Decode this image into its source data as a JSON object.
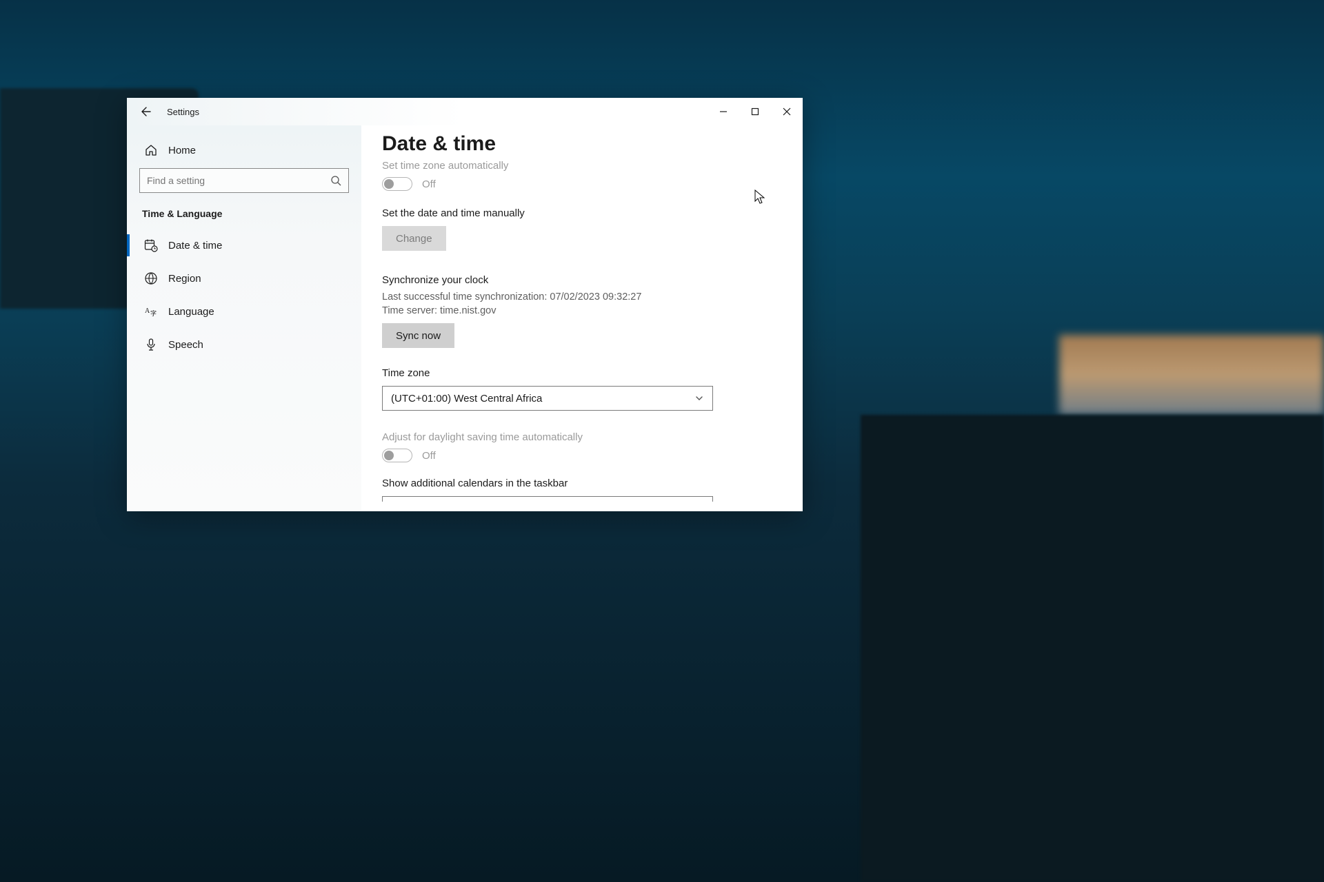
{
  "window": {
    "title": "Settings"
  },
  "sidebar": {
    "home_label": "Home",
    "search_placeholder": "Find a setting",
    "section_title": "Time & Language",
    "items": [
      {
        "label": "Date & time"
      },
      {
        "label": "Region"
      },
      {
        "label": "Language"
      },
      {
        "label": "Speech"
      }
    ]
  },
  "page": {
    "title": "Date & time",
    "auto_tz": {
      "label": "Set time zone automatically",
      "state": "Off"
    },
    "manual": {
      "label": "Set the date and time manually",
      "button": "Change"
    },
    "sync": {
      "heading": "Synchronize your clock",
      "last_sync": "Last successful time synchronization: 07/02/2023 09:32:27",
      "server": "Time server: time.nist.gov",
      "button": "Sync now"
    },
    "tz": {
      "label": "Time zone",
      "value": "(UTC+01:00) West Central Africa"
    },
    "dst": {
      "label": "Adjust for daylight saving time automatically",
      "state": "Off"
    },
    "calendars": {
      "label": "Show additional calendars in the taskbar"
    }
  }
}
